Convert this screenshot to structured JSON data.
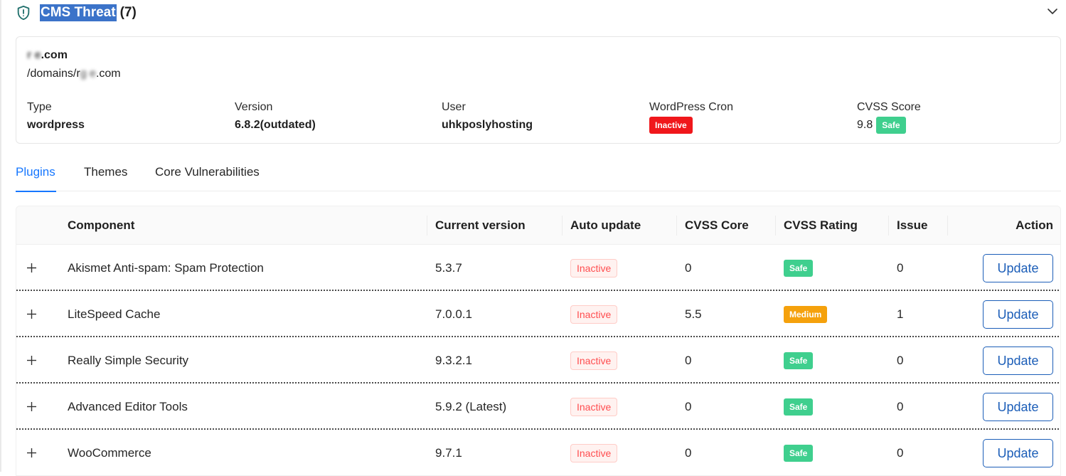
{
  "header": {
    "title": "CMS Threat",
    "count": "(7)",
    "icon": "shield-alert-icon",
    "collapse_icon": "chevron-down-icon"
  },
  "site": {
    "domain": {
      "prefix": "r    e",
      "suffix": ".com"
    },
    "path": {
      "prefix": "/domains/r",
      "masked": "   g e",
      "suffix": ".com"
    },
    "fields": {
      "type": {
        "label": "Type",
        "value": "wordpress"
      },
      "version": {
        "label": "Version",
        "value": "6.8.2(outdated)"
      },
      "user": {
        "label": "User",
        "value": "uhkposlyhosting"
      },
      "cron": {
        "label": "WordPress Cron",
        "value": "Inactive",
        "color": "#f0171b"
      },
      "cvss": {
        "label": "CVSS Score",
        "value": "9.8",
        "rating": "Safe",
        "color": "#3fcf8e"
      }
    }
  },
  "tabs": [
    {
      "label": "Plugins",
      "active": true
    },
    {
      "label": "Themes",
      "active": false
    },
    {
      "label": "Core Vulnerabilities",
      "active": false
    }
  ],
  "table": {
    "columns": {
      "component": "Component",
      "current_version": "Current version",
      "auto_update": "Auto update",
      "cvss_core": "CVSS Core",
      "cvss_rating": "CVSS Rating",
      "issue": "Issue",
      "action": "Action"
    },
    "rows": [
      {
        "component": "Akismet Anti-spam: Spam Protection",
        "version": "5.3.7",
        "auto_update": "Inactive",
        "cvss_core": "0",
        "rating": "Safe",
        "issue": "0",
        "action": "Update"
      },
      {
        "component": "LiteSpeed Cache",
        "version": "7.0.0.1",
        "auto_update": "Inactive",
        "cvss_core": "5.5",
        "rating": "Medium",
        "issue": "1",
        "action": "Update"
      },
      {
        "component": "Really Simple Security",
        "version": "9.3.2.1",
        "auto_update": "Inactive",
        "cvss_core": "0",
        "rating": "Safe",
        "issue": "0",
        "action": "Update"
      },
      {
        "component": "Advanced Editor Tools",
        "version": "5.9.2 (Latest)",
        "auto_update": "Inactive",
        "cvss_core": "0",
        "rating": "Safe",
        "issue": "0",
        "action": "Update"
      },
      {
        "component": "WooCommerce",
        "version": "9.7.1",
        "auto_update": "Inactive",
        "cvss_core": "0",
        "rating": "Safe",
        "issue": "0",
        "action": "Update"
      }
    ],
    "rating_colors": {
      "Safe": "#3fcf8e",
      "Medium": "#f5a10c"
    },
    "expand_icon": "plus-icon"
  }
}
